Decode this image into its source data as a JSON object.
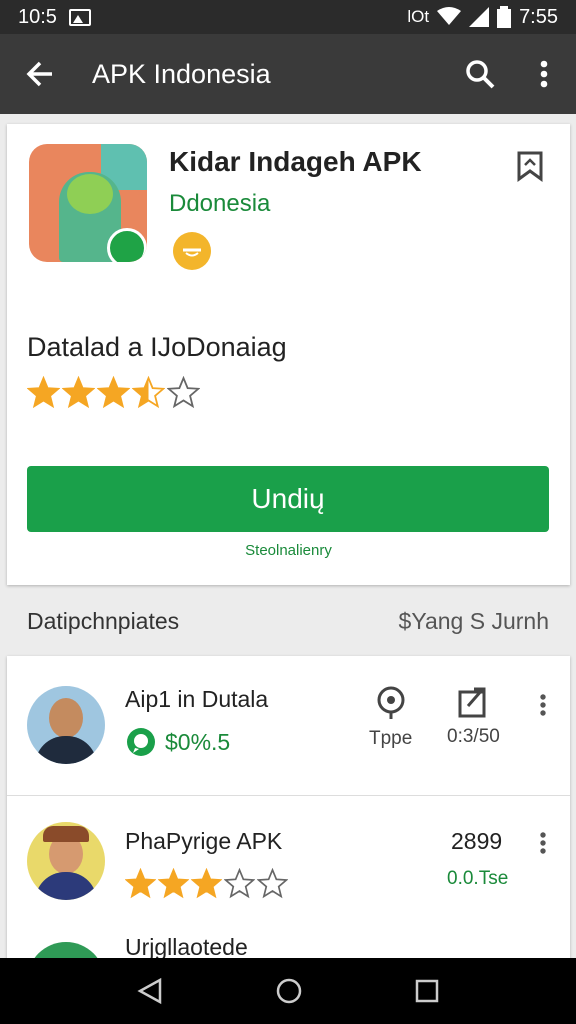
{
  "status_bar": {
    "time_left": "10:5",
    "signal_text": "lOt",
    "time_right": "7:55"
  },
  "app_bar": {
    "title": "APK Indonesia"
  },
  "app": {
    "name": "Kidar Indageh APK",
    "developer": "Ddonesia",
    "subtitle": "Datalad  a IJoDonaiag",
    "rating": 3.5,
    "install_label": "Undių",
    "install_note": "Steolnalienry"
  },
  "section": {
    "left": "Datipchnpiates",
    "right": "$Yang S Jurnh"
  },
  "list": [
    {
      "title": "Aip1 in Dutala",
      "price": "$0%.5",
      "col1_label": "Tppe",
      "col2_label": "0:3/50"
    },
    {
      "title": "PhaPyrige APK",
      "rating": 3,
      "price": "2899",
      "sub": "0.0.Tse"
    },
    {
      "title": "Urjgllaotede"
    }
  ],
  "colors": {
    "accent": "#1aa04a",
    "appbar": "#3a3a3a",
    "star": "#f5a623"
  }
}
